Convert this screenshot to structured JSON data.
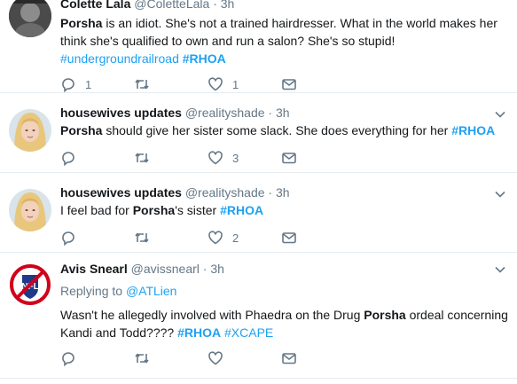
{
  "tweets": [
    {
      "name": "Colette Lala",
      "handle": "@ColetteLala",
      "sep": "·",
      "time": "3h",
      "text": [
        {
          "t": "Porsha",
          "b": true
        },
        {
          "t": " is an idiot. She's not a trained hairdresser. What in the world makes her think she's qualified to own and run a salon? She's so stupid! "
        },
        {
          "t": "#undergroundrailroad",
          "tag": true
        },
        {
          "t": " "
        },
        {
          "t": "#RHOA",
          "tag": true,
          "b": true
        }
      ],
      "replies": "1",
      "retweets": "",
      "likes": "1"
    },
    {
      "name": "housewives updates",
      "handle": "@realityshade",
      "sep": "·",
      "time": "3h",
      "text": [
        {
          "t": "Porsha",
          "b": true
        },
        {
          "t": " should give her sister some slack. She does everything for her "
        },
        {
          "t": "#RHOA",
          "tag": true,
          "b": true
        }
      ],
      "replies": "",
      "retweets": "",
      "likes": "3"
    },
    {
      "name": "housewives updates",
      "handle": "@realityshade",
      "sep": "·",
      "time": "3h",
      "text": [
        {
          "t": "I feel bad for "
        },
        {
          "t": "Porsha",
          "b": true
        },
        {
          "t": "'s sister "
        },
        {
          "t": "#RHOA",
          "tag": true,
          "b": true
        }
      ],
      "replies": "",
      "retweets": "",
      "likes": "2"
    },
    {
      "name": "Avis Snearl",
      "handle": "@avissnearl",
      "sep": "·",
      "time": "3h",
      "replying_prefix": "Replying to",
      "replying_to": "@ATLien",
      "text": [
        {
          "t": "Wasn't he allegedly involved with Phaedra on the Drug "
        },
        {
          "t": "Porsha",
          "b": true
        },
        {
          "t": " ordeal concerning Kandi and Todd???? "
        },
        {
          "t": "#RHOA",
          "tag": true,
          "b": true
        },
        {
          "t": " "
        },
        {
          "t": "#XCAPE",
          "tag": true
        }
      ],
      "replies": "",
      "retweets": "",
      "likes": ""
    }
  ],
  "icons": {
    "reply": "reply-icon",
    "retweet": "retweet-icon",
    "like": "heart-icon",
    "dm": "envelope-icon",
    "caret": "chevron-down-icon"
  },
  "colors": {
    "link": "#1da1f2",
    "secondary": "#657786",
    "divider": "#e6ecf0"
  }
}
